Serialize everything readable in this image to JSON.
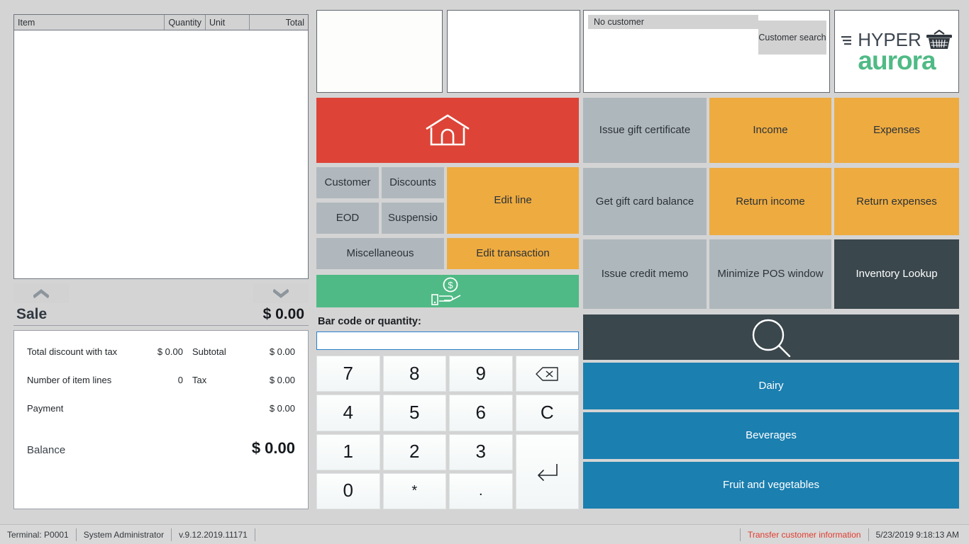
{
  "receipt": {
    "columns": [
      "Item",
      "Quantity",
      "Unit",
      "Total"
    ],
    "rows": [],
    "sale_label": "Sale",
    "sale_amount": "$ 0.00",
    "totals": [
      {
        "label": "Total discount with tax",
        "value": "$ 0.00",
        "label2": "Subtotal",
        "value2": "$ 0.00"
      },
      {
        "label": "Number of item lines",
        "value": "0",
        "label2": "Tax",
        "value2": "$ 0.00"
      },
      {
        "label": "Payment",
        "value": "",
        "label2": "",
        "value2": "$ 0.00"
      }
    ],
    "balance_label": "Balance",
    "balance_amount": "$ 0.00"
  },
  "center": {
    "home_icon": "home-icon",
    "buttons": {
      "customer": "Customer",
      "discounts": "Discounts",
      "eod": "EOD",
      "suspension": "Suspensio",
      "edit_line": "Edit line",
      "miscellaneous": "Miscellaneous",
      "edit_transaction": "Edit transaction",
      "payment_icon": "hand-holding-coin-icon"
    },
    "barcode_label": "Bar code or quantity:",
    "barcode_value": "",
    "barcode_placeholder": "",
    "keypad": [
      "7",
      "8",
      "9",
      "⌫",
      "4",
      "5",
      "6",
      "C",
      "1",
      "2",
      "3",
      "↵",
      "0",
      "*",
      "."
    ]
  },
  "customer": {
    "name": "No customer",
    "search_label": "Customer search"
  },
  "logo": {
    "top_text": "HYPER",
    "bottom_text": "aurora",
    "basket_icon": "shopping-basket-icon",
    "green": "#4fba85",
    "dark": "#3e4650"
  },
  "right_grid": [
    {
      "label": "Issue gift certificate",
      "style": "gray"
    },
    {
      "label": "Income",
      "style": "orange"
    },
    {
      "label": "Expenses",
      "style": "orange"
    },
    {
      "label": "Get gift card balance",
      "style": "gray"
    },
    {
      "label": "Return income",
      "style": "orange"
    },
    {
      "label": "Return expenses",
      "style": "orange"
    },
    {
      "label": "Issue credit memo",
      "style": "gray"
    },
    {
      "label": "Minimize POS window",
      "style": "gray"
    },
    {
      "label": "Inventory Lookup",
      "style": "dark"
    }
  ],
  "categories": {
    "search_icon": "magnifier-icon",
    "items": [
      "Dairy",
      "Beverages",
      "Fruit and  vegetables"
    ]
  },
  "status_bar": {
    "terminal": "Terminal: P0001",
    "user": "System Administrator",
    "version": "v.9.12.2019.11171",
    "transfer_message": "Transfer customer information",
    "timestamp": "5/23/2019 9:18:13 AM"
  },
  "colors": {
    "accent_red": "#dd4437",
    "accent_orange": "#eeab40",
    "accent_green": "#4fba85",
    "accent_blue": "#1b7fb0",
    "accent_dark": "#3a474d",
    "button_gray": "#aeb7bc",
    "background": "#d4d4d4",
    "status_red": "#e03b2f"
  }
}
